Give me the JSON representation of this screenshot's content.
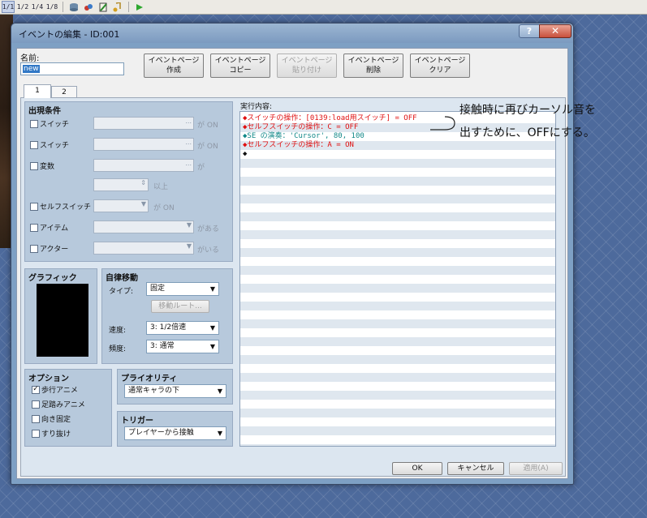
{
  "toolbar": {
    "buttons": [
      "1/1",
      "1/2",
      "1/4",
      "1/8"
    ]
  },
  "dialog": {
    "title": "イベントの編集 - ID:001",
    "help": "?",
    "close": "✕"
  },
  "name_field": {
    "label": "名前:",
    "value": "new"
  },
  "page_buttons": [
    {
      "line1": "イベントページ",
      "line2": "作成"
    },
    {
      "line1": "イベントページ",
      "line2": "コピー"
    },
    {
      "line1": "イベントページ",
      "line2": "貼り付け"
    },
    {
      "line1": "イベントページ",
      "line2": "削除"
    },
    {
      "line1": "イベントページ",
      "line2": "クリア"
    }
  ],
  "tabs": [
    "1",
    "2"
  ],
  "conditions": {
    "title": "出現条件",
    "rows": [
      {
        "label": "スイッチ",
        "suffix": "が ON"
      },
      {
        "label": "スイッチ",
        "suffix": "が ON"
      },
      {
        "label": "変数",
        "suffix": "が"
      },
      {
        "label": "",
        "suffix": "以上"
      },
      {
        "label": "セルフスイッチ",
        "suffix": "が ON"
      },
      {
        "label": "アイテム",
        "suffix": "がある"
      },
      {
        "label": "アクター",
        "suffix": "がいる"
      }
    ]
  },
  "graphic": {
    "title": "グラフィック"
  },
  "autonomous": {
    "title": "自律移動",
    "type_label": "タイプ:",
    "type_value": "固定",
    "route_button": "移動ルート...",
    "speed_label": "速度:",
    "speed_value": "3: 1/2倍速",
    "freq_label": "頻度:",
    "freq_value": "3: 通常"
  },
  "options": {
    "title": "オプション",
    "items": [
      {
        "label": "歩行アニメ",
        "checked": "✓"
      },
      {
        "label": "足踏みアニメ",
        "checked": ""
      },
      {
        "label": "向き固定",
        "checked": ""
      },
      {
        "label": "すり抜け",
        "checked": ""
      }
    ]
  },
  "priority": {
    "title": "プライオリティ",
    "value": "通常キャラの下"
  },
  "trigger": {
    "title": "トリガー",
    "value": "プレイヤーから接触"
  },
  "exec": {
    "label": "実行内容:",
    "lines": [
      "◆スイッチの操作：[0139:load用スイッチ] = OFF",
      "◆セルフスイッチの操作：C = OFF",
      "◆SE の演奏：'Cursor', 80, 100",
      "◆セルフスイッチの操作：A = ON",
      "◆"
    ],
    "colors": [
      "#e01010",
      "#e01010",
      "#118888",
      "#e01010",
      "#111111"
    ]
  },
  "annotation": {
    "line1": "接触時に再びカーソル音を",
    "line2": "出すために、OFFにする。"
  },
  "footer": {
    "ok": "OK",
    "cancel": "キャンセル",
    "apply": "適用(A)"
  }
}
